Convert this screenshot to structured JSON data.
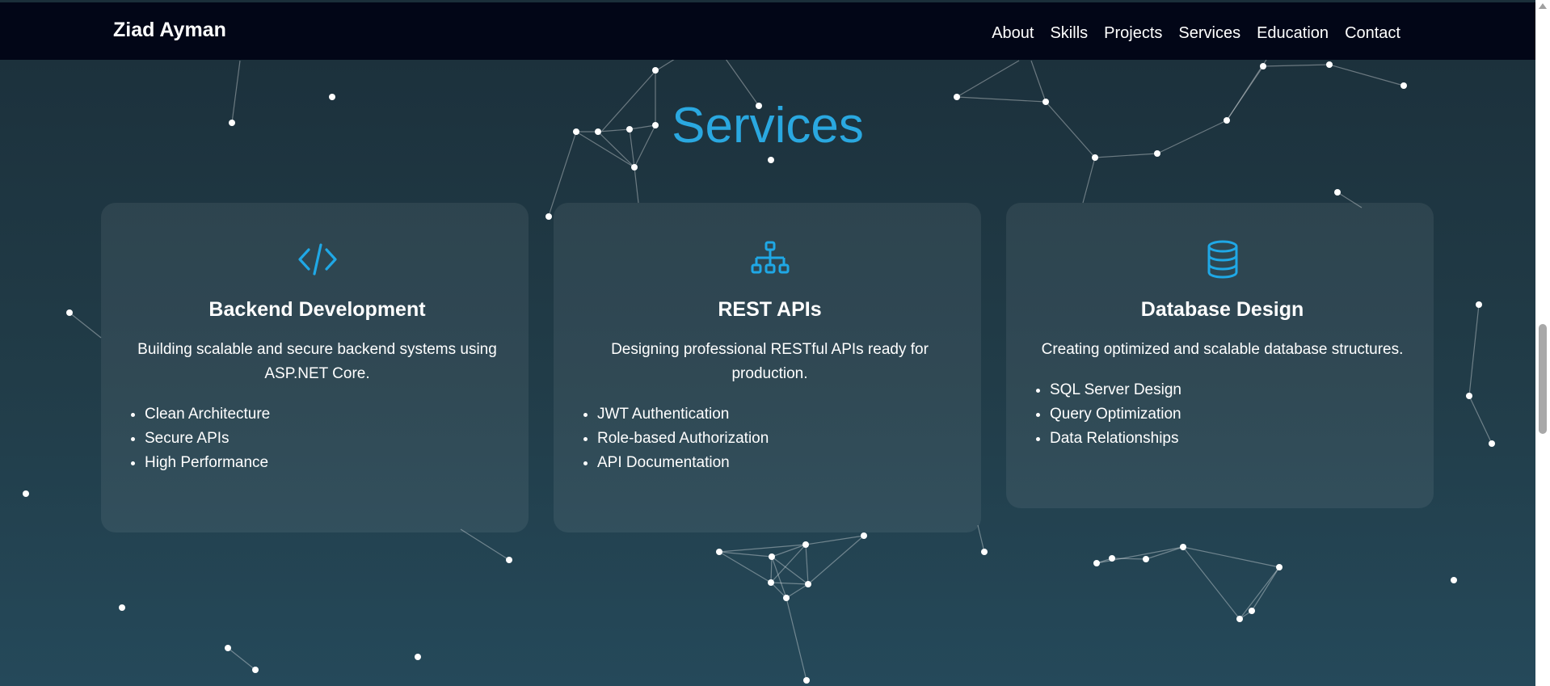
{
  "header": {
    "brand": "Ziad Ayman",
    "nav": [
      "About",
      "Skills",
      "Projects",
      "Services",
      "Education",
      "Contact"
    ]
  },
  "services": {
    "title": "Services",
    "cards": [
      {
        "icon": "code-icon",
        "title": "Backend Development",
        "description": "Building scalable and secure backend systems using ASP.NET Core.",
        "features": [
          "Clean Architecture",
          "Secure APIs",
          "High Performance"
        ]
      },
      {
        "icon": "sitemap-icon",
        "title": "REST APIs",
        "description": "Designing professional RESTful APIs ready for production.",
        "features": [
          "JWT Authentication",
          "Role-based Authorization",
          "API Documentation"
        ]
      },
      {
        "icon": "database-icon",
        "title": "Database Design",
        "description": "Creating optimized and scalable database structures.",
        "features": [
          "SQL Server Design",
          "Query Optimization",
          "Data Relationships"
        ]
      }
    ]
  },
  "colors": {
    "accent": "#2aa8e0",
    "navbar": "#020617",
    "background": "#213c48"
  }
}
